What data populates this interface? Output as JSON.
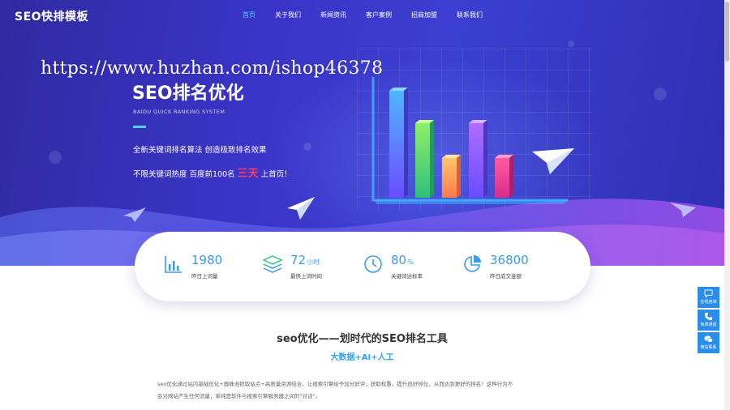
{
  "header": {
    "logo": "SEO快排模板",
    "nav": [
      {
        "label": "首页",
        "active": true
      },
      {
        "label": "关于我们",
        "active": false
      },
      {
        "label": "新闻资讯",
        "active": false
      },
      {
        "label": "客户案例",
        "active": false
      },
      {
        "label": "招商加盟",
        "active": false
      },
      {
        "label": "联系我们",
        "active": false
      }
    ]
  },
  "watermark": "https://www.huzhan.com/ishop46378",
  "hero": {
    "title": "SEO排名优化",
    "subtitle": "BAIDU QUICK RANKING SYSTEM",
    "line1": "全新关键词排名算法 创造极致排名效果",
    "line2_before": "不限关键词热度 百度前100名",
    "line2_highlight": "三天",
    "line2_after": "上首页！",
    "highlight_color": "#ff3b5c",
    "accent_color": "#4fd2ff"
  },
  "stats": [
    {
      "value": "1980",
      "unit": "",
      "label": "昨日上词量",
      "icon": "bar-chart-icon"
    },
    {
      "value": "72",
      "unit": "小时",
      "label": "最快上词时间",
      "icon": "layers-icon"
    },
    {
      "value": "80",
      "unit": "%",
      "label": "关键词达标率",
      "icon": "clock-icon"
    },
    {
      "value": "36800",
      "unit": "",
      "label": "昨日成交金额",
      "icon": "pie-chart-icon"
    }
  ],
  "section": {
    "title": "seo优化——划时代的SEO排名工具",
    "subtitle": "大数据+AI+人工",
    "body_line1": "seo优化通过站内基础优化+蜘蛛池抓取站点+高质量资源结合，让搜索引擎给予加分好评，获取权重，提升良好排位，从而达到更好的排名！这种行为不",
    "body_line2": "会对网站产生任何流量，单纯是软件与搜索引擎服务器之间的\"对话\"。"
  },
  "side_widgets": [
    {
      "label": "在线咨询",
      "icon": "chat-icon"
    },
    {
      "label": "免费通话",
      "icon": "phone-icon"
    },
    {
      "label": "微信联系",
      "icon": "wechat-icon"
    }
  ],
  "colors": {
    "stat_number": "#3a9bf0",
    "side_widget": "#2a8ee8",
    "section_subtitle": "#2ea3f2"
  }
}
